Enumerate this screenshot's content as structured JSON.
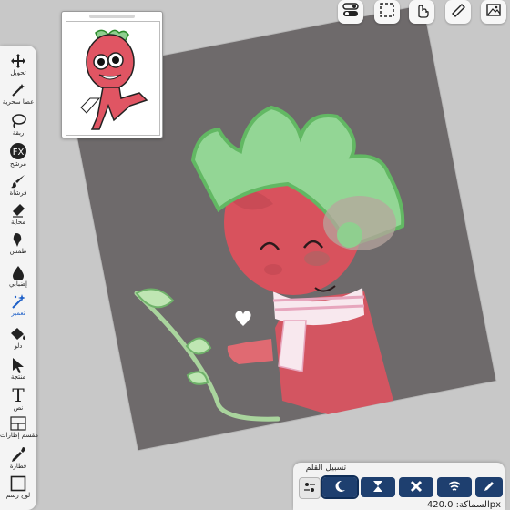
{
  "tools": [
    {
      "label": "تحويل",
      "icon": "move-icon"
    },
    {
      "label": "عصا سحرية",
      "icon": "magic-wand-icon"
    },
    {
      "label": "ربقة",
      "icon": "lasso-icon"
    },
    {
      "label": "مرشح",
      "icon": "fx-icon",
      "badge": "FX"
    },
    {
      "label": "فرشاة",
      "icon": "brush-icon"
    },
    {
      "label": "محاية",
      "icon": "eraser-icon"
    },
    {
      "label": "طمس",
      "icon": "smudge-icon"
    },
    {
      "label": "إضبابي",
      "icon": "blur-icon"
    },
    {
      "label": "تعمير",
      "icon": "sparkle-icon"
    },
    {
      "label": "دلو",
      "icon": "bucket-icon"
    },
    {
      "label": "منتجة",
      "icon": "select-arrow-icon"
    },
    {
      "label": "نص",
      "icon": "text-icon",
      "glyph": "T"
    },
    {
      "label": "مقسم إطارات",
      "icon": "frame-divider-icon"
    },
    {
      "label": "قطارة",
      "icon": "eyedropper-icon"
    },
    {
      "label": "لوح رسم",
      "icon": "canvas-icon"
    }
  ],
  "top_buttons": [
    {
      "name": "toggle-icon"
    },
    {
      "name": "selection-icon"
    },
    {
      "name": "gesture-icon"
    },
    {
      "name": "ruler-icon"
    },
    {
      "name": "gallery-icon"
    }
  ],
  "stabilizer": {
    "title": "تسبيل القلم",
    "modes": [
      "settings-icon",
      "moon-icon",
      "hourglass-icon",
      "x-icon",
      "wifi-icon",
      "pen-icon"
    ],
    "selected_index": 1,
    "status": "السماكة: 420.0px"
  },
  "colors": {
    "canvas": "#6e6a6b",
    "body": "#c8404a",
    "leaf": "#8fcf8f",
    "stabilizer_button": "#1e3f6f"
  }
}
